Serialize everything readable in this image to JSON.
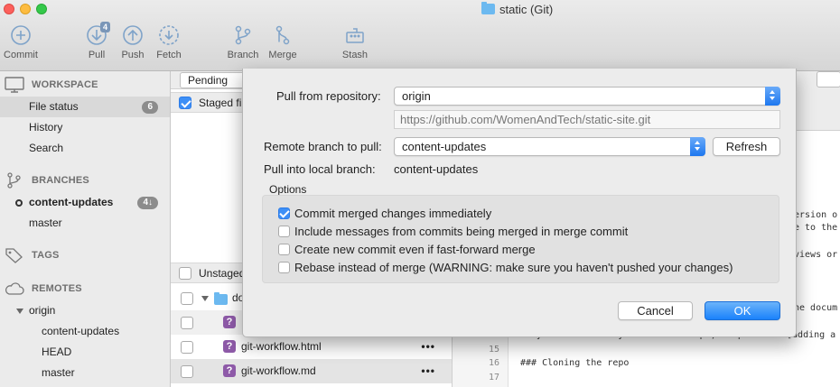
{
  "window": {
    "title": "static (Git)"
  },
  "toolbar": {
    "commit": "Commit",
    "pull": "Pull",
    "pull_badge": "4",
    "push": "Push",
    "fetch": "Fetch",
    "branch": "Branch",
    "merge": "Merge",
    "stash": "Stash"
  },
  "sidebar": {
    "workspace": {
      "header": "WORKSPACE",
      "items": [
        "File status",
        "History",
        "Search"
      ],
      "file_status_count": "6"
    },
    "branches": {
      "header": "BRANCHES",
      "current": "content-updates",
      "current_badge": "4↓",
      "other": "master"
    },
    "tags": {
      "header": "TAGS"
    },
    "remotes": {
      "header": "REMOTES",
      "origin": "origin",
      "children": [
        "content-updates",
        "HEAD",
        "master"
      ]
    }
  },
  "filelist": {
    "pending_label": "Pending files",
    "staged_header": "Staged files",
    "unstaged_header": "Unstaged files",
    "folder": "docs",
    "files": [
      "git-workflow.html",
      "git-workflow.md"
    ],
    "more": "•••"
  },
  "diff": {
    "lines": [
      {
        "n": "",
        "text": "ersion o"
      },
      {
        "n": "",
        "text": "e to the"
      },
      {
        "n": "",
        "text": "views or"
      },
      {
        "n": "",
        "text": "he docum"
      },
      {
        "n": "14",
        "text": "If you have already cloned the repo, skip to the [adding a"
      },
      {
        "n": "15",
        "text": ""
      },
      {
        "n": "16",
        "text": "### Cloning the repo"
      },
      {
        "n": "17",
        "text": ""
      }
    ]
  },
  "dialog": {
    "pull_from_label": "Pull from repository:",
    "repository": "origin",
    "url": "https://github.com/WomenAndTech/static-site.git",
    "remote_branch_label": "Remote branch to pull:",
    "remote_branch": "content-updates",
    "refresh": "Refresh",
    "local_branch_label": "Pull into local branch:",
    "local_branch": "content-updates",
    "options_label": "Options",
    "options": [
      {
        "label": "Commit merged changes immediately",
        "checked": true
      },
      {
        "label": "Include messages from commits being merged in merge commit",
        "checked": false
      },
      {
        "label": "Create new commit even if fast-forward merge",
        "checked": false
      },
      {
        "label": "Rebase instead of merge (WARNING: make sure you haven't pushed your changes)",
        "checked": false
      }
    ],
    "cancel": "Cancel",
    "ok": "OK"
  },
  "colors": {
    "accent": "#1a82fb",
    "selection": "#d9d9d9",
    "badge": "#8c8c8c",
    "file_badge": "#8e5aa8"
  }
}
